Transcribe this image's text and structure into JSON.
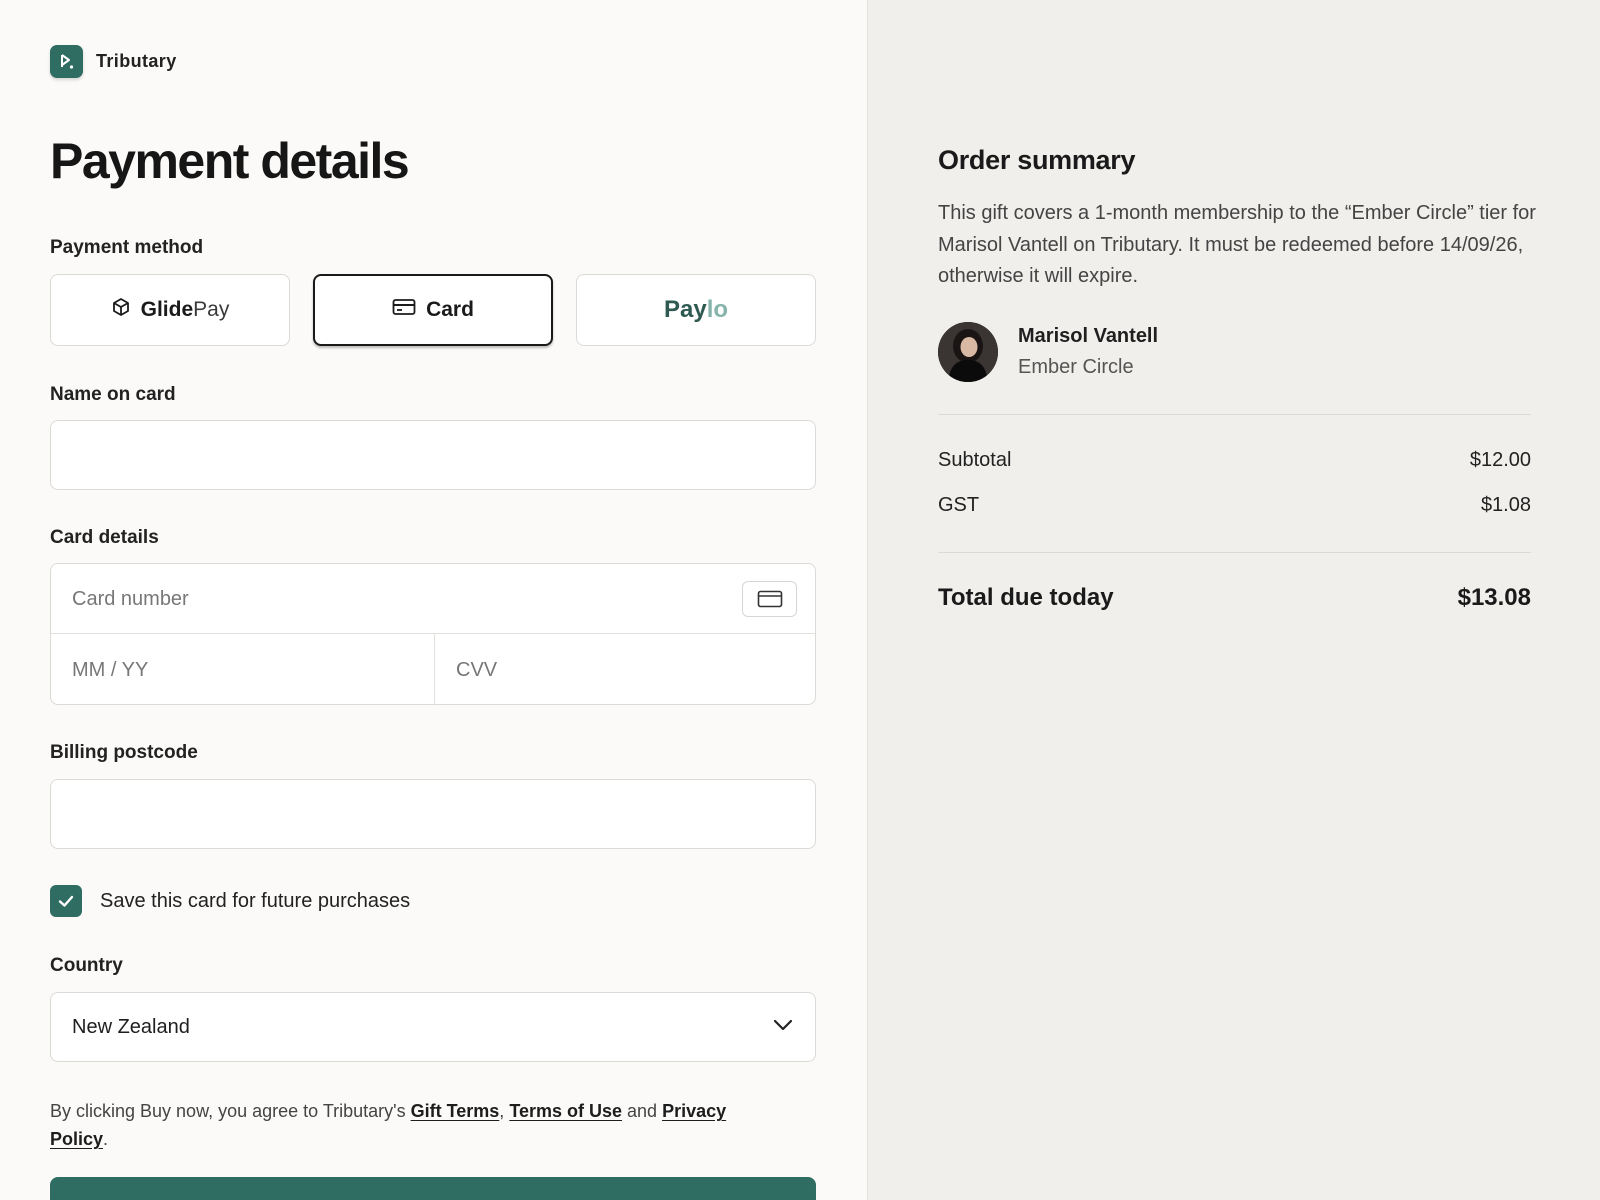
{
  "brand": {
    "name": "Tributary",
    "color": "#2f6d63"
  },
  "page": {
    "title": "Payment details"
  },
  "payment_method": {
    "label": "Payment method",
    "options": [
      {
        "name_bold": "Glide",
        "name_light": "Pay",
        "icon": "box-icon"
      },
      {
        "name": "Card",
        "icon": "credit-card-icon",
        "selected": true
      },
      {
        "name_a": "Pay",
        "name_b": "lo"
      }
    ]
  },
  "name_on_card": {
    "label": "Name on card",
    "value": ""
  },
  "card_details": {
    "label": "Card details",
    "number_placeholder": "Card number",
    "expiry_placeholder": "MM / YY",
    "cvv_placeholder": "CVV"
  },
  "billing": {
    "label": "Billing postcode",
    "value": ""
  },
  "save_card": {
    "label": "Save this card for future purchases",
    "checked": true
  },
  "country": {
    "label": "Country",
    "value": "New Zealand"
  },
  "terms": {
    "prefix": "By clicking Buy now, you agree to Tributary's ",
    "gift_terms": "Gift Terms",
    "comma": ", ",
    "terms_of_use": "Terms of Use",
    "and": " and ",
    "privacy": "Privacy Policy",
    "suffix": "."
  },
  "summary": {
    "title": "Order summary",
    "description": "This gift covers a 1-month membership to the “Ember Circle” tier for Marisol Vantell on Tributary. It must be redeemed before 14/09/26, otherwise it will expire.",
    "recipient_name": "Marisol Vantell",
    "recipient_tier": "Ember Circle",
    "subtotal_label": "Subtotal",
    "subtotal_value": "$12.00",
    "gst_label": "GST",
    "gst_value": "$1.08",
    "total_label": "Total due today",
    "total_value": "$13.08"
  }
}
